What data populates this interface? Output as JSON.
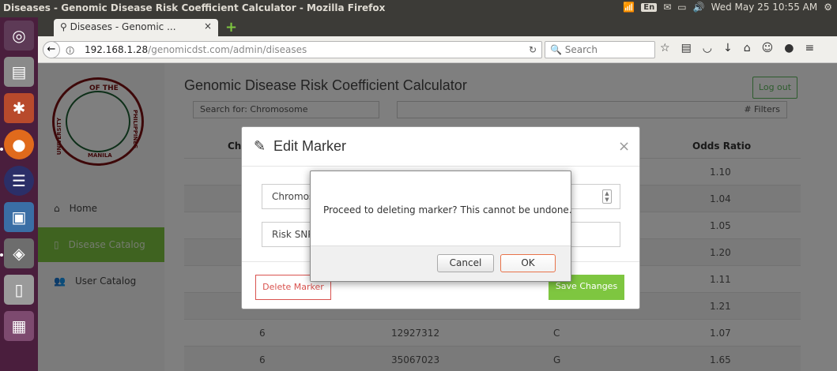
{
  "window": {
    "title": "Diseases - Genomic Disease Risk Coefficient Calculator - Mozilla Firefox"
  },
  "tray": {
    "lang": "En",
    "datetime": "Wed May 25 10:55 AM"
  },
  "browser": {
    "tab_title": "Diseases - Genomic ...",
    "tab_close": "×",
    "new_tab": "+",
    "url_host": "192.168.1.28",
    "url_path": "/genomicdst.com/admin/diseases",
    "search_placeholder": "Search"
  },
  "page": {
    "app_title": "Genomic Disease Risk Coefficient Calculator",
    "logout_label": "Log out",
    "seal": {
      "text_top": "OF THE",
      "text_left": "UNIVERSITY",
      "text_right": "PHILIPPINES",
      "text_bottom": "MANILA"
    },
    "sidebar": [
      {
        "icon": "home-icon",
        "label": "Home"
      },
      {
        "icon": "book-icon",
        "label": "Disease Catalog",
        "active": true
      },
      {
        "icon": "users-icon",
        "label": "User Catalog"
      }
    ],
    "filter_left": "Search for: Chromosome",
    "filter_right": "# Filters",
    "table": {
      "headers": [
        "Chr",
        "Odds Ratio"
      ],
      "rows": [
        {
          "chr": "",
          "snp": "",
          "allele": "",
          "odds": "1.10"
        },
        {
          "chr": "",
          "snp": "",
          "allele": "",
          "odds": "1.04"
        },
        {
          "chr": "",
          "snp": "",
          "allele": "",
          "odds": "1.05"
        },
        {
          "chr": "",
          "snp": "",
          "allele": "",
          "odds": "1.20"
        },
        {
          "chr": "",
          "snp": "",
          "allele": "",
          "odds": "1.11"
        },
        {
          "chr": "",
          "snp": "",
          "allele": "",
          "odds": "1.21"
        },
        {
          "chr": "6",
          "snp": "12927312",
          "allele": "C",
          "odds": "1.07"
        },
        {
          "chr": "6",
          "snp": "35067023",
          "allele": "G",
          "odds": "1.65"
        }
      ]
    }
  },
  "modal": {
    "title": "Edit Marker",
    "close": "×",
    "field_chromosome": "Chromos",
    "field_risk_snp": "Risk SNP",
    "delete_label": "Delete Marker",
    "save_label": "Save Changes"
  },
  "confirm": {
    "message": "Proceed to deleting marker? This cannot be undone.",
    "cancel_label": "Cancel",
    "ok_label": "OK"
  }
}
